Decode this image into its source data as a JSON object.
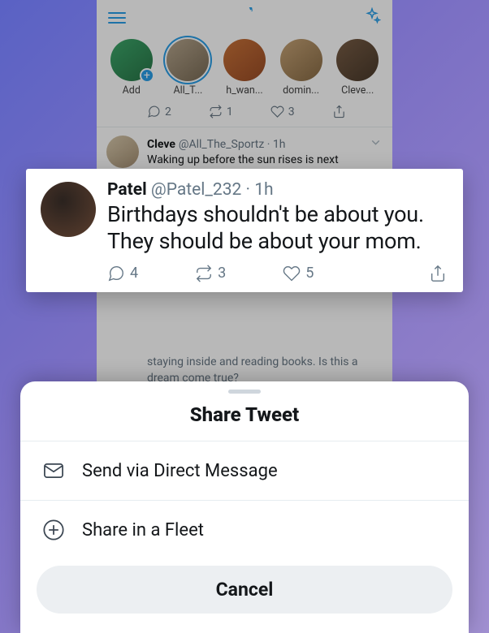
{
  "fleets": [
    {
      "label": "Add"
    },
    {
      "label": "All_T..."
    },
    {
      "label": "h_wan..."
    },
    {
      "label": "domin..."
    },
    {
      "label": "Cleve..."
    }
  ],
  "bg_counts": {
    "reply": "2",
    "retweet": "1",
    "like": "3"
  },
  "bg_tweet": {
    "name": "Cleve",
    "handle": "@All_The_Sportz",
    "time": "1h",
    "text": "Waking up before the sun rises is next"
  },
  "bg_tweet2_text": "staying inside and reading books. Is this a dream come true?",
  "highlight": {
    "name": "Patel",
    "handle": "@Patel_232",
    "time": "1h",
    "text": "Birthdays shouldn't be about you. They should be about your mom.",
    "reply": "4",
    "retweet": "3",
    "like": "5"
  },
  "sheet": {
    "title": "Share Tweet",
    "dm": "Send via Direct Message",
    "fleet": "Share in a Fleet",
    "cancel": "Cancel"
  }
}
